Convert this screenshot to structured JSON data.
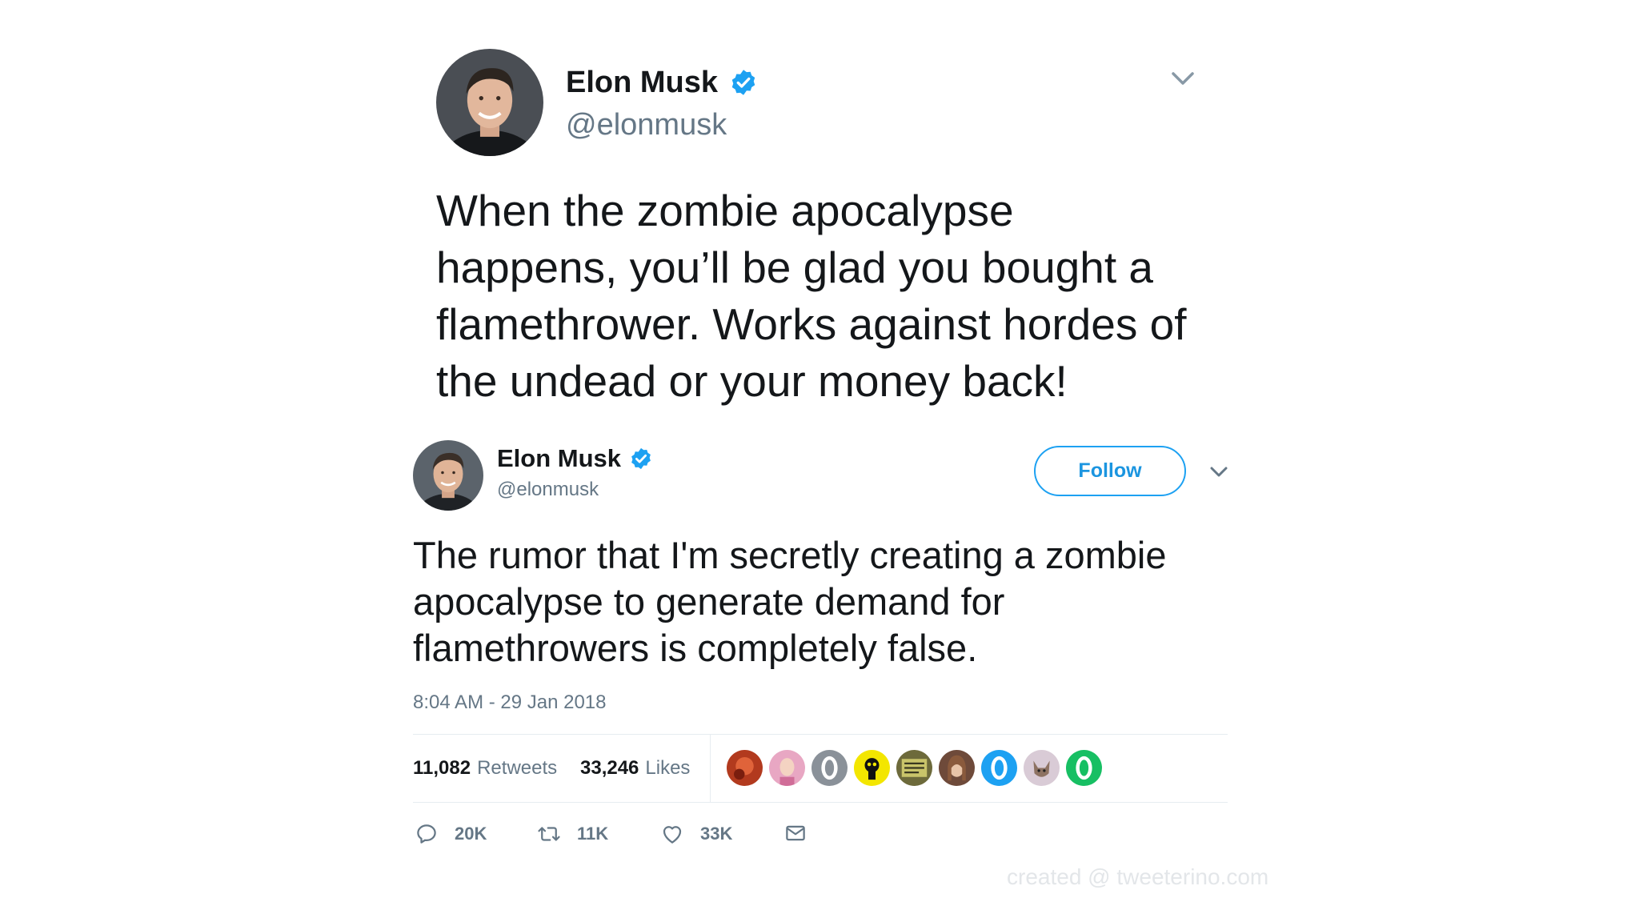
{
  "tweet_main": {
    "author_name": "Elon Musk",
    "author_handle": "@elonmusk",
    "verified_icon": "verified-badge-icon",
    "menu_icon": "chevron-down-icon",
    "text": "When the zombie apocalypse happens, you’ll be glad you bought a flamethrower. Works against hordes of the undead or your money back!"
  },
  "tweet_embedded": {
    "author_name": "Elon Musk",
    "author_handle": "@elonmusk",
    "follow_label": "Follow",
    "text": "The rumor that I'm secretly creating a zombie apocalypse to generate demand for flamethrowers is completely false.",
    "timestamp": "8:04 AM - 29 Jan 2018",
    "retweets_count": "11,082",
    "retweets_label": "Retweets",
    "likes_count": "33,246",
    "likes_label": "Likes",
    "actions": {
      "reply_count": "20K",
      "retweet_count": "11K",
      "like_count": "33K"
    }
  },
  "watermark": "created @ tweeterino.com",
  "colors": {
    "accent": "#1da1f2",
    "text_primary": "#14171a",
    "text_secondary": "#657786"
  }
}
